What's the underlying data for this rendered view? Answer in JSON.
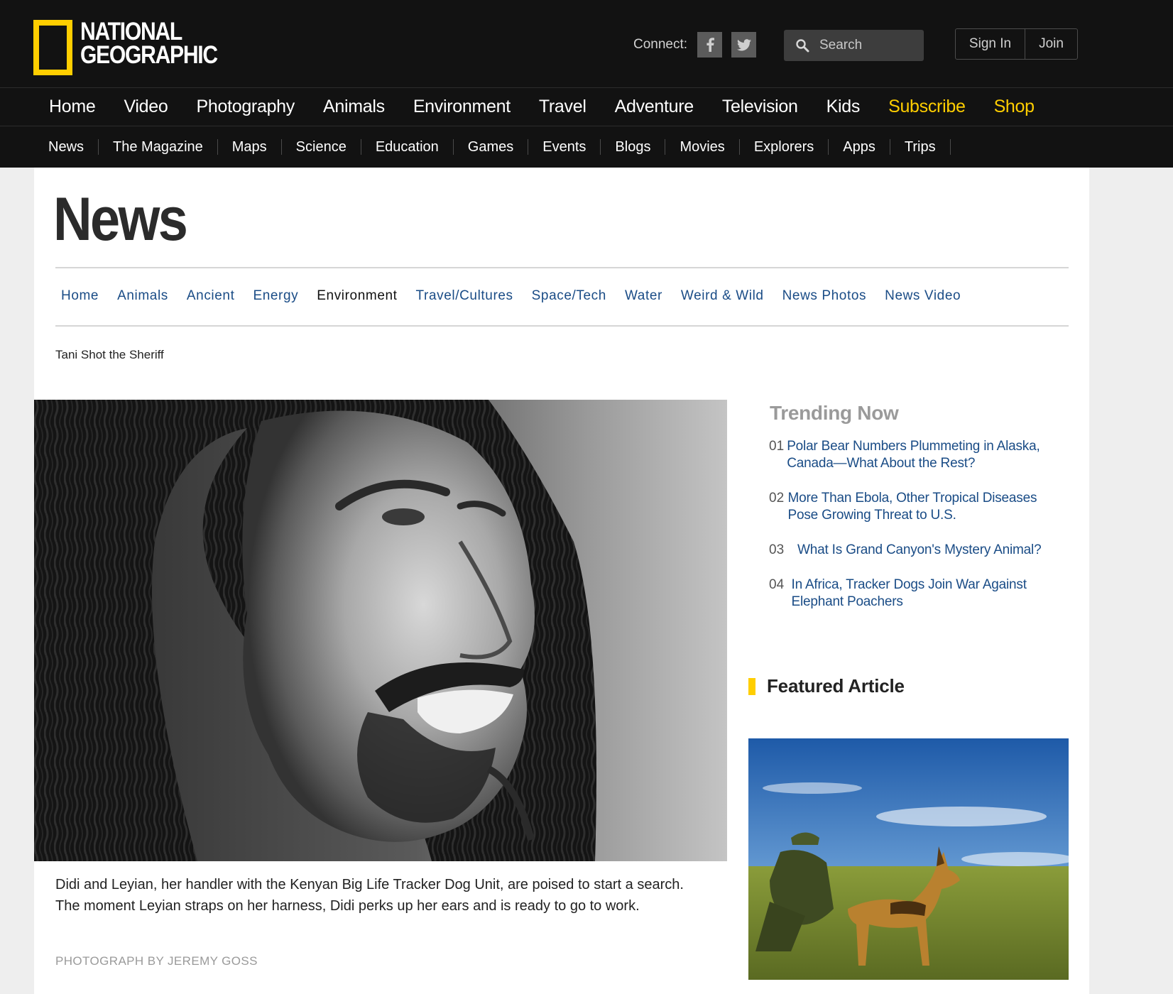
{
  "brand": {
    "line1": "NATIONAL",
    "line2": "GEOGRAPHIC",
    "accent": "#ffce00"
  },
  "header": {
    "connect_label": "Connect:",
    "social": [
      "facebook-icon",
      "twitter-icon"
    ],
    "search_placeholder": "Search",
    "sign_in": "Sign In",
    "join": "Join"
  },
  "main_nav": [
    {
      "label": "Home"
    },
    {
      "label": "Video"
    },
    {
      "label": "Photography"
    },
    {
      "label": "Animals"
    },
    {
      "label": "Environment"
    },
    {
      "label": "Travel"
    },
    {
      "label": "Adventure"
    },
    {
      "label": "Television"
    },
    {
      "label": "Kids"
    },
    {
      "label": "Subscribe"
    },
    {
      "label": "Shop"
    }
  ],
  "sub_nav": [
    {
      "label": "News"
    },
    {
      "label": "The Magazine"
    },
    {
      "label": "Maps"
    },
    {
      "label": "Science"
    },
    {
      "label": "Education"
    },
    {
      "label": "Games"
    },
    {
      "label": "Events"
    },
    {
      "label": "Blogs"
    },
    {
      "label": "Movies"
    },
    {
      "label": "Explorers"
    },
    {
      "label": "Apps"
    },
    {
      "label": "Trips"
    }
  ],
  "section": {
    "title": "News",
    "nav": [
      {
        "label": "Home"
      },
      {
        "label": "Animals"
      },
      {
        "label": "Ancient"
      },
      {
        "label": "Energy"
      },
      {
        "label": "Environment",
        "active": true
      },
      {
        "label": "Travel/Cultures"
      },
      {
        "label": "Space/Tech"
      },
      {
        "label": "Water"
      },
      {
        "label": "Weird & Wild"
      },
      {
        "label": "News Photos"
      },
      {
        "label": "News Video"
      }
    ]
  },
  "article": {
    "kicker": "Tani Shot the Sheriff",
    "caption": "Didi and Leyian, her handler with the Kenyan Big Life Tracker Dog Unit, are poised to start a search. The moment Leyian straps on her harness, Didi perks up her ears and is ready to go to work.",
    "credit": "PHOTOGRAPH BY JEREMY GOSS"
  },
  "sidebar": {
    "trending_title": "Trending Now",
    "trending": [
      {
        "num": "01",
        "title": "Polar Bear Numbers Plummeting in Alaska, Canada—What About the Rest?"
      },
      {
        "num": "02",
        "title": "More Than Ebola, Other Tropical Diseases Pose Growing Threat to U.S."
      },
      {
        "num": "03",
        "title": "What Is Grand Canyon's Mystery Animal?"
      },
      {
        "num": "04",
        "title": "In Africa, Tracker Dogs Join War Against Elephant Poachers"
      }
    ],
    "featured_title": "Featured Article"
  },
  "colors": {
    "link": "#1a4c86",
    "header_bg": "#121212",
    "yellow": "#ffce00"
  }
}
